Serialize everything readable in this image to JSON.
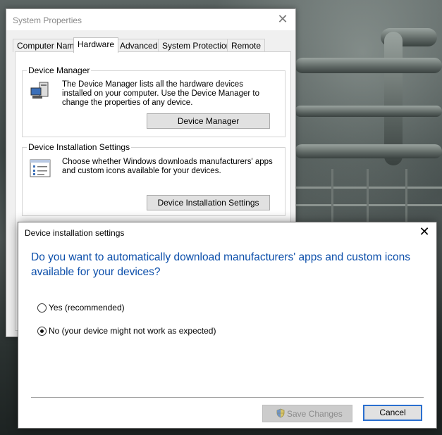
{
  "system_properties": {
    "title": "System Properties",
    "close_glyph": "✕",
    "tabs": [
      {
        "label": "Computer Name",
        "active": false
      },
      {
        "label": "Hardware",
        "active": true
      },
      {
        "label": "Advanced",
        "active": false
      },
      {
        "label": "System Protection",
        "active": false
      },
      {
        "label": "Remote",
        "active": false
      }
    ],
    "device_manager": {
      "legend": "Device Manager",
      "description": "The Device Manager lists all the hardware devices installed on your computer. Use the Device Manager to change the properties of any device.",
      "button": "Device Manager",
      "icon": "computer-icon"
    },
    "device_installation": {
      "legend": "Device Installation Settings",
      "description": "Choose whether Windows downloads manufacturers' apps and custom icons available for your devices.",
      "button": "Device Installation Settings",
      "icon": "checklist-icon"
    }
  },
  "dialog": {
    "title": "Device installation settings",
    "close_glyph": "✕",
    "question": "Do you want to automatically download manufacturers' apps and custom icons available for your devices?",
    "options": [
      {
        "label": "Yes (recommended)",
        "checked": false
      },
      {
        "label": "No (your device might not work as expected)",
        "checked": true
      }
    ],
    "save_button": "Save Changes",
    "save_enabled": false,
    "save_icon": "uac-shield-icon",
    "cancel_button": "Cancel"
  },
  "colors": {
    "question_text": "#0b4eaa",
    "focus_border": "#2a6fd0"
  }
}
